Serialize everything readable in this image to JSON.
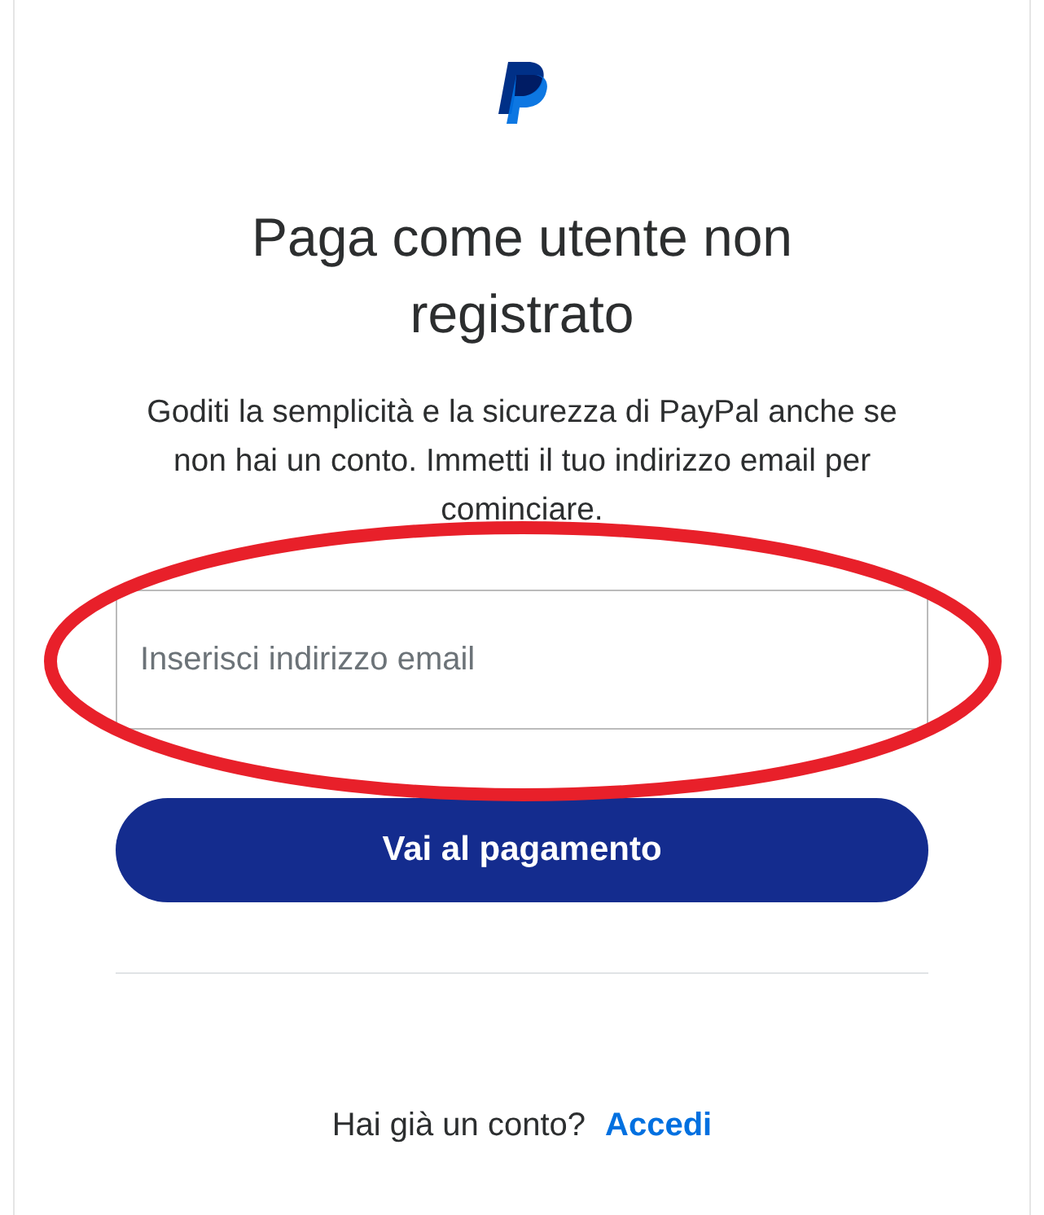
{
  "title": "Paga come utente non registrato",
  "description": "Goditi la semplicità e la sicurezza di PayPal anche se non hai un conto. Immetti il tuo indirizzo email per cominciare.",
  "email_field": {
    "placeholder": "Inserisci indirizzo email"
  },
  "submit_button": "Vai al pagamento",
  "footer": {
    "question": "Hai già un conto?",
    "link": "Accedi"
  },
  "annotation": {
    "kind": "ellipse",
    "color": "#e8202a"
  }
}
